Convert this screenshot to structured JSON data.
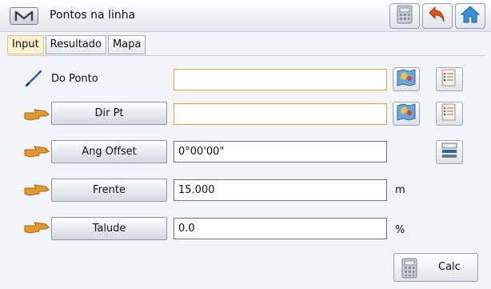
{
  "window": {
    "title": "Pontos na linha",
    "menu_icon": "m-logo-icon",
    "toolbar_icons": [
      "calculator-icon",
      "back-arrow-icon",
      "home-icon"
    ]
  },
  "tabs": [
    {
      "label": "Input",
      "active": true
    },
    {
      "label": "Resultado",
      "active": false
    },
    {
      "label": "Mapa",
      "active": false
    }
  ],
  "form": {
    "from_point": {
      "label": "Do Ponto",
      "value": "",
      "icon": "pencil-icon"
    },
    "dir_pt": {
      "label": "Dir Pt",
      "value": "",
      "icon": "pointing-hand-icon"
    },
    "ang_offset": {
      "label": "Ang Offset",
      "value": "0°00'00\"",
      "icon": "pointing-hand-icon"
    },
    "front": {
      "label": "Frente",
      "value": "15.000",
      "unit": "m",
      "icon": "pointing-hand-icon"
    },
    "slope": {
      "label": "Talude",
      "value": "0.0",
      "unit": "%",
      "icon": "pointing-hand-icon"
    }
  },
  "calc": {
    "label": "Calc",
    "icon": "calculator-icon"
  },
  "colors": {
    "highlight_border": "#e0a43a",
    "active_tab": "#fdf1cf",
    "hand_icon": "#e09a2b"
  }
}
